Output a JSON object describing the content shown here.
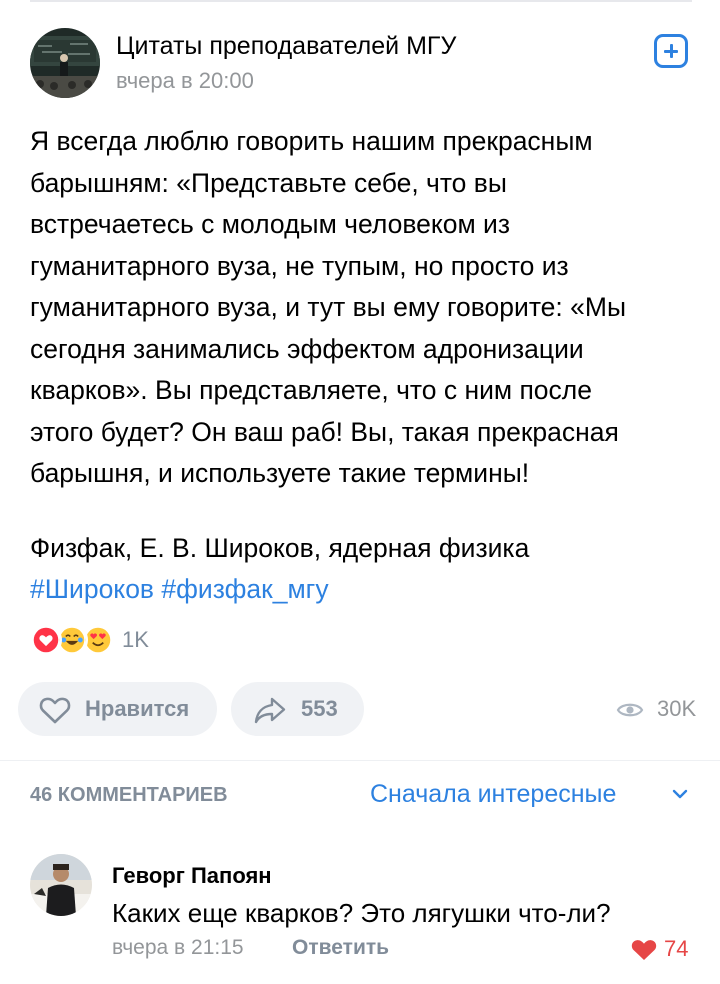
{
  "post": {
    "group_name": "Цитаты преподавателей МГУ",
    "time": "вчера в 20:00",
    "subscribe_icon": "plus-square-icon",
    "text": "Я всегда люблю говорить нашим прекрасным\nбарышням: «Представьте себе, что вы\nвстречаетесь с молодым человеком из\nгуманитарного вуза, не тупым, но просто из\nгуманитарного вуза, и тут вы ему говорите: «Мы\nсегодня занимались эффектом адронизации\nкварков». Вы представляете, что с ним после\nэтого будет? Он ваш раб! Вы, такая прекрасная\nбарышня, и используете такие термины!",
    "signature": "Физфак, Е. В. Широков, ядерная физика",
    "hashtags": [
      "#Широков",
      "#физфак_мгу"
    ],
    "reactions": {
      "icons": [
        "heart-reaction-icon",
        "laughing-tears-icon",
        "heart-eyes-icon"
      ],
      "count": "1K"
    },
    "actions": {
      "like_label": "Нравится",
      "share_count": "553",
      "views_count": "30K"
    }
  },
  "comments": {
    "header": "46 КОММЕНТАРИЕВ",
    "sort_label": "Сначала интересные",
    "items": [
      {
        "author": "Геворг Папоян",
        "text": "Каких еще кварков? Это лягушки что-ли?",
        "time": "вчера в 21:15",
        "reply_label": "Ответить",
        "likes": "74"
      }
    ]
  },
  "colors": {
    "accent": "#2d81e0",
    "muted": "#818c99",
    "like": "#e64646",
    "button_bg": "#f0f2f5"
  }
}
